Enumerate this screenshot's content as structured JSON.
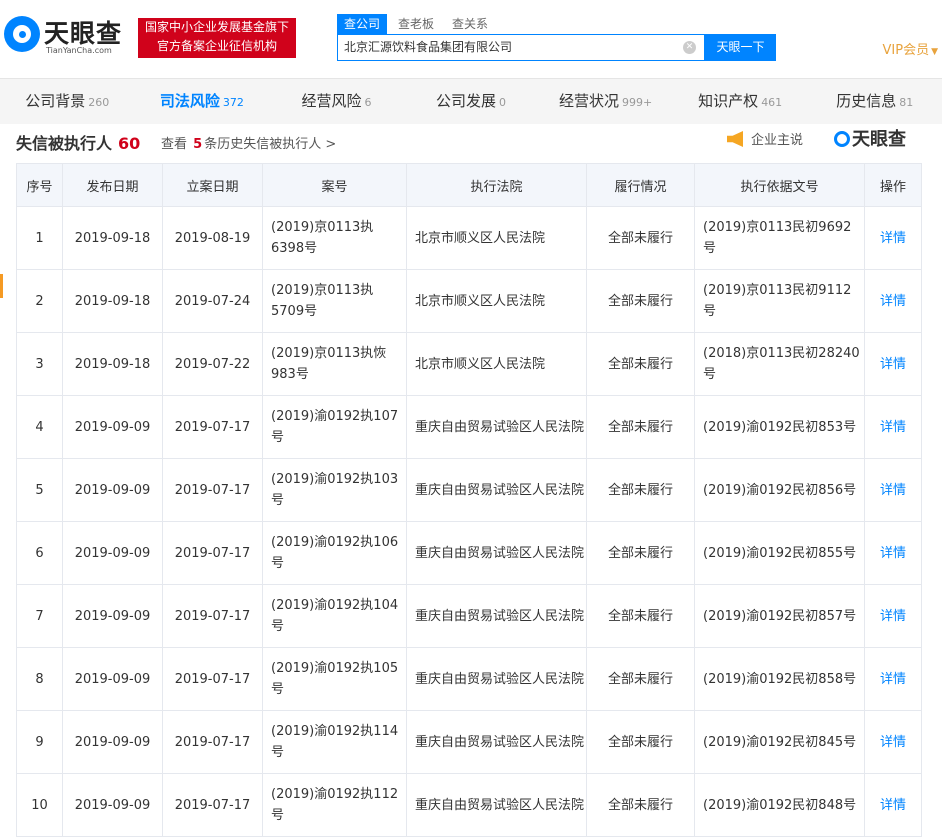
{
  "header": {
    "logo_cn": "天眼查",
    "logo_en": "TianYanCha.com",
    "banner_line1": "国家中小企业发展基金旗下",
    "banner_line2": "官方备案企业征信机构",
    "search_tabs": [
      "查公司",
      "查老板",
      "查关系"
    ],
    "search_value": "北京汇源饮料食品集团有限公司",
    "search_button": "天眼一下",
    "vip_label": "VIP会员"
  },
  "nav": [
    {
      "label": "公司背景",
      "count": "260"
    },
    {
      "label": "司法风险",
      "count": "372"
    },
    {
      "label": "经营风险",
      "count": "6"
    },
    {
      "label": "公司发展",
      "count": "0"
    },
    {
      "label": "经营状况",
      "count": "999+"
    },
    {
      "label": "知识产权",
      "count": "461"
    },
    {
      "label": "历史信息",
      "count": "81"
    }
  ],
  "section": {
    "title": "失信被执行人",
    "count": "60",
    "history_prefix": "查看",
    "history_num": "5",
    "history_suffix": "条历史失信被执行人 >",
    "speaker_label": "企业主说",
    "brand": "天眼查"
  },
  "table": {
    "headers": [
      "序号",
      "发布日期",
      "立案日期",
      "案号",
      "执行法院",
      "履行情况",
      "执行依据文号",
      "操作"
    ],
    "rows": [
      {
        "no": "1",
        "pub": "2019-09-18",
        "filed": "2019-08-19",
        "case": "(2019)京0113执6398号",
        "court": "北京市顺义区人民法院",
        "status": "全部未履行",
        "basis": "(2019)京0113民初9692号",
        "action": "详情"
      },
      {
        "no": "2",
        "pub": "2019-09-18",
        "filed": "2019-07-24",
        "case": "(2019)京0113执5709号",
        "court": "北京市顺义区人民法院",
        "status": "全部未履行",
        "basis": "(2019)京0113民初9112号",
        "action": "详情"
      },
      {
        "no": "3",
        "pub": "2019-09-18",
        "filed": "2019-07-22",
        "case": "(2019)京0113执恢983号",
        "court": "北京市顺义区人民法院",
        "status": "全部未履行",
        "basis": "(2018)京0113民初28240号",
        "action": "详情"
      },
      {
        "no": "4",
        "pub": "2019-09-09",
        "filed": "2019-07-17",
        "case": "(2019)渝0192执107号",
        "court": "重庆自由贸易试验区人民法院",
        "status": "全部未履行",
        "basis": "(2019)渝0192民初853号",
        "action": "详情"
      },
      {
        "no": "5",
        "pub": "2019-09-09",
        "filed": "2019-07-17",
        "case": "(2019)渝0192执103号",
        "court": "重庆自由贸易试验区人民法院",
        "status": "全部未履行",
        "basis": "(2019)渝0192民初856号",
        "action": "详情"
      },
      {
        "no": "6",
        "pub": "2019-09-09",
        "filed": "2019-07-17",
        "case": "(2019)渝0192执106号",
        "court": "重庆自由贸易试验区人民法院",
        "status": "全部未履行",
        "basis": "(2019)渝0192民初855号",
        "action": "详情"
      },
      {
        "no": "7",
        "pub": "2019-09-09",
        "filed": "2019-07-17",
        "case": "(2019)渝0192执104号",
        "court": "重庆自由贸易试验区人民法院",
        "status": "全部未履行",
        "basis": "(2019)渝0192民初857号",
        "action": "详情"
      },
      {
        "no": "8",
        "pub": "2019-09-09",
        "filed": "2019-07-17",
        "case": "(2019)渝0192执105号",
        "court": "重庆自由贸易试验区人民法院",
        "status": "全部未履行",
        "basis": "(2019)渝0192民初858号",
        "action": "详情"
      },
      {
        "no": "9",
        "pub": "2019-09-09",
        "filed": "2019-07-17",
        "case": "(2019)渝0192执114号",
        "court": "重庆自由贸易试验区人民法院",
        "status": "全部未履行",
        "basis": "(2019)渝0192民初845号",
        "action": "详情"
      },
      {
        "no": "10",
        "pub": "2019-09-09",
        "filed": "2019-07-17",
        "case": "(2019)渝0192执112号",
        "court": "重庆自由贸易试验区人民法院",
        "status": "全部未履行",
        "basis": "(2019)渝0192民初848号",
        "action": "详情"
      }
    ]
  }
}
